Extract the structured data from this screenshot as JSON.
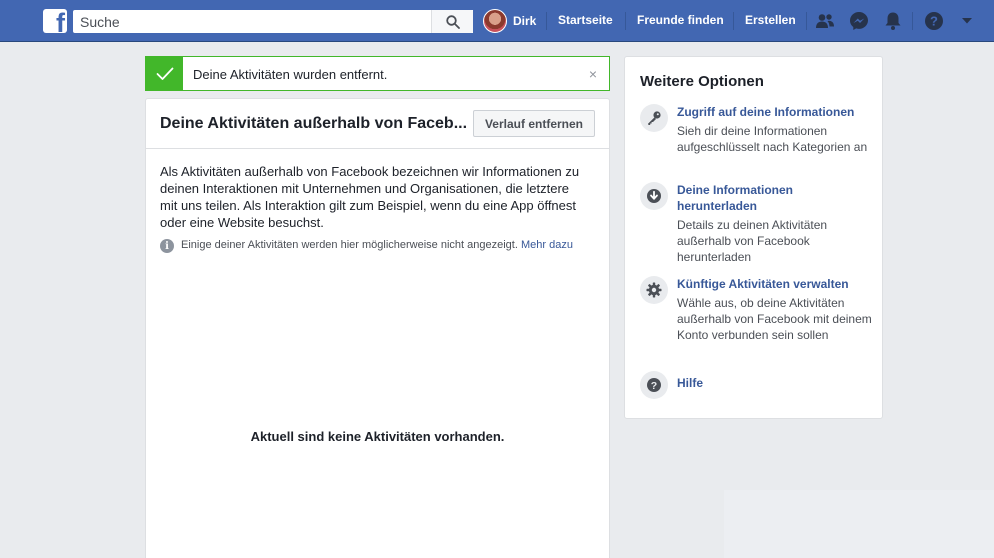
{
  "nav": {
    "logo": "f",
    "search_placeholder": "Suche",
    "user_name": "Dirk",
    "links": [
      "Startseite",
      "Freunde finden",
      "Erstellen"
    ],
    "icons": [
      "friends-icon",
      "messenger-icon",
      "notifications-icon",
      "help-icon",
      "dropdown-icon"
    ]
  },
  "banner": {
    "message": "Deine Aktivitäten wurden entfernt.",
    "close": "×"
  },
  "main": {
    "title": "Deine Aktivitäten außerhalb von Faceb...",
    "clear_button": "Verlauf entfernen",
    "description": "Als Aktivitäten außerhalb von Facebook bezeichnen wir Informationen zu deinen Interaktionen mit Unternehmen und Organisationen, die letztere mit uns teilen. Als Interaktion gilt zum Beispiel, wenn du eine App öffnest oder eine Website besuchst.",
    "note": "Einige deiner Aktivitäten werden hier möglicherweise nicht angezeigt.",
    "note_link": "Mehr dazu",
    "empty_state": "Aktuell sind keine Aktivitäten vorhanden."
  },
  "sidebar": {
    "title": "Weitere Optionen",
    "options": [
      {
        "title": "Zugriff auf deine Informationen",
        "description": "Sieh dir deine Informationen aufgeschlüsselt nach Kategorien an",
        "icon": "key-icon"
      },
      {
        "title": "Deine Informationen herunterladen",
        "description": "Details zu deinen Aktivitäten außerhalb von Facebook herunterladen",
        "icon": "download-icon"
      },
      {
        "title": "Künftige Aktivitäten verwalten",
        "description": "Wähle aus, ob deine Aktivitäten außerhalb von Facebook mit deinem Konto verbunden sein sollen",
        "icon": "gear-icon"
      },
      {
        "title": "Hilfe",
        "description": "",
        "icon": "help-icon"
      }
    ]
  },
  "colors": {
    "brand": "#4267b2",
    "success": "#42b72a",
    "link": "#385898",
    "background": "#e9ebee"
  }
}
